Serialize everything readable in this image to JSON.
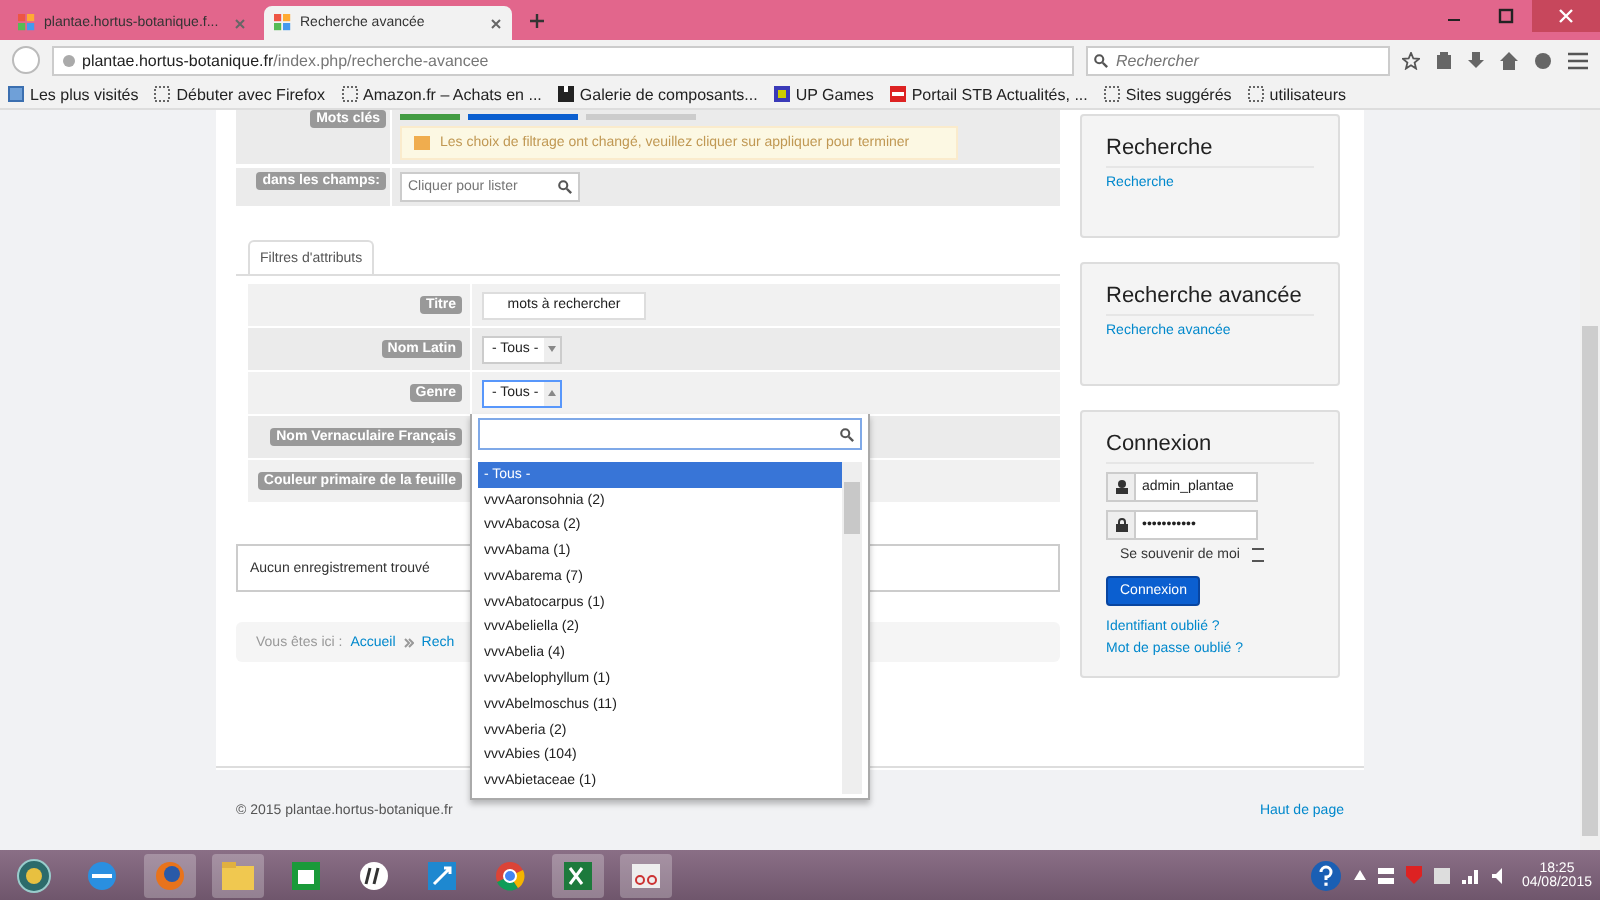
{
  "browser": {
    "tabs": [
      {
        "title": "plantae.hortus-botanique.f...",
        "selected": false
      },
      {
        "title": "Recherche avancée",
        "selected": true
      }
    ],
    "url_host": "plantae.hortus-botanique.fr",
    "url_path": "/index.php/recherche-avancee",
    "search": {
      "placeholder": "Rechercher"
    },
    "bookmarks": [
      {
        "label": "Les plus visités",
        "kind": "history"
      },
      {
        "label": "Débuter avec Firefox",
        "kind": "page"
      },
      {
        "label": "Amazon.fr – Achats en ...",
        "kind": "page"
      },
      {
        "label": "Galerie de composants...",
        "kind": "puzzle"
      },
      {
        "label": "UP Games",
        "kind": "games"
      },
      {
        "label": "Portail STB Actualités, ...",
        "kind": "news"
      },
      {
        "label": "Sites suggérés",
        "kind": "page"
      },
      {
        "label": "utilisateurs",
        "kind": "page"
      }
    ]
  },
  "search_form": {
    "rows": [
      {
        "label": "Mots clés",
        "kind": "notice",
        "text": "Les choix de filtrage ont changé, veuillez cliquer sur appliquer pour terminer"
      },
      {
        "label": "dans les champs:",
        "kind": "field",
        "placeholder": "Cliquer pour lister"
      }
    ]
  },
  "filters": {
    "tab": "Filtres d'attributs",
    "rows": [
      {
        "label": "Titre",
        "kind": "text",
        "value": "mots à rechercher"
      },
      {
        "label": "Nom Latin",
        "kind": "select",
        "value": "- Tous -",
        "expanded": false
      },
      {
        "label": "Genre",
        "kind": "select",
        "value": "- Tous -",
        "expanded": true
      },
      {
        "label": "Nom Vernaculaire Français",
        "kind": "covered"
      },
      {
        "label": "Couleur primaire de la feuille",
        "kind": "covered"
      }
    ]
  },
  "dropdown": {
    "options": [
      {
        "label": "- Tous -",
        "selected": true
      },
      {
        "label": "vvvAaronsohnia (2)",
        "selected": false
      },
      {
        "label": "vvvAbacosa (2)",
        "selected": false
      },
      {
        "label": "vvvAbama (1)",
        "selected": false
      },
      {
        "label": "vvvAbarema (7)",
        "selected": false
      },
      {
        "label": "vvvAbatocarpus (1)",
        "selected": false
      },
      {
        "label": "vvvAbeliella (2)",
        "selected": false
      },
      {
        "label": "vvvAbelia (4)",
        "selected": false
      },
      {
        "label": "vvvAbelophyllum (1)",
        "selected": false
      },
      {
        "label": "vvvAbelmoschus (11)",
        "selected": false
      },
      {
        "label": "vvvAberia (2)",
        "selected": false
      },
      {
        "label": "vvvAbies (104)",
        "selected": false
      },
      {
        "label": "vvvAbietaceae (1)",
        "selected": false
      }
    ]
  },
  "results": {
    "message": "Aucun enregistrement trouvé"
  },
  "breadcrumb": {
    "prefix": "Vous êtes ici :",
    "items": [
      "Accueil",
      "Rech"
    ]
  },
  "sidebar": {
    "cards": [
      {
        "title": "Recherche",
        "links": [
          "Recherche"
        ]
      },
      {
        "title": "Recherche avancée",
        "links": [
          "Recherche avancée"
        ]
      }
    ],
    "login": {
      "title": "Connexion",
      "username": "admin_plantae",
      "password": "•••••••••••",
      "remember": "Se souvenir de moi",
      "remember_checked": false,
      "button": "Connexion",
      "links": [
        "Identifiant oublié ?",
        "Mot de passe oublié ?"
      ]
    }
  },
  "footer": {
    "copyright": "© 2015 plantae.hortus-botanique.fr",
    "top_link": "Haut de page"
  },
  "taskbar": {
    "time": "18:25",
    "date": "04/08/2015"
  }
}
